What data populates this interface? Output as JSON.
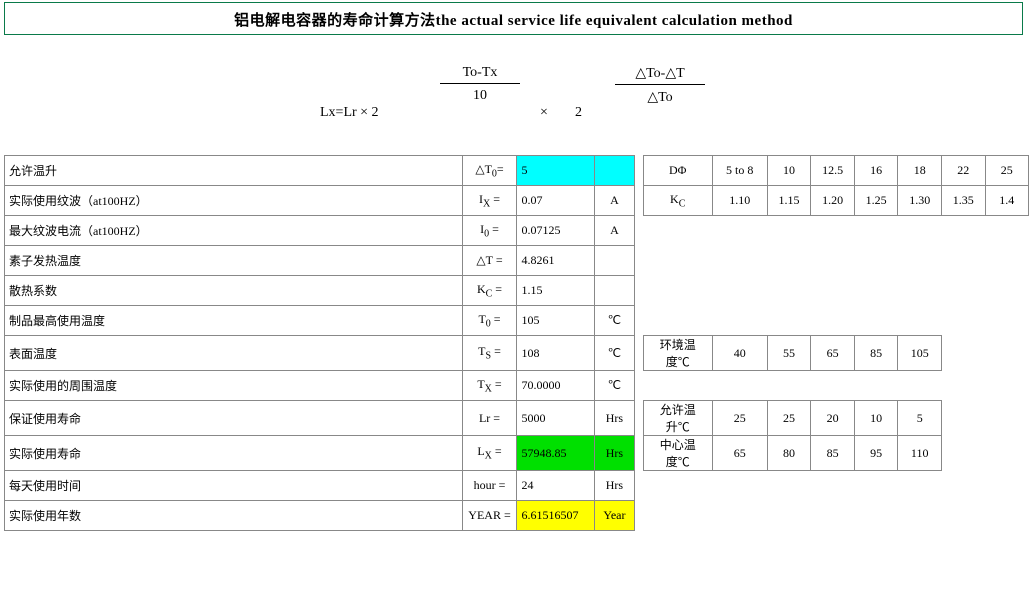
{
  "title": "铝电解电容器的寿命计算方法the actual service life equivalent calculation method",
  "formula": {
    "prefix": "Lx=Lr × 2",
    "frac1_num": "To-Tx",
    "frac1_den": "10",
    "times": "×",
    "base2": "2",
    "frac2_num": "△To-△T",
    "frac2_den": "△To"
  },
  "rows": {
    "r1": {
      "label": "允许温升",
      "sym": "△T0=",
      "val": "5",
      "unit": ""
    },
    "r2": {
      "label": "实际使用纹波（at100HZ）",
      "sym": "IX =",
      "val": "0.07",
      "unit": "A"
    },
    "r3": {
      "label": "最大纹波电流（at100HZ）",
      "sym": "I0 =",
      "val": "0.07125",
      "unit": "A"
    },
    "r4": {
      "label": "素子发热温度",
      "sym": "△T =",
      "val": "4.8261",
      "unit": ""
    },
    "r5": {
      "label": "散热系数",
      "sym": "KC =",
      "val": "1.15",
      "unit": ""
    },
    "r6": {
      "label": "制品最高使用温度",
      "sym": "T0 =",
      "val": "105",
      "unit": "℃"
    },
    "r7": {
      "label": "表面温度",
      "sym": "TS =",
      "val": "108",
      "unit": "℃"
    },
    "r8": {
      "label": "实际使用的周围温度",
      "sym": "TX =",
      "val": "70.0000",
      "unit": "℃"
    },
    "r9": {
      "label": "保证使用寿命",
      "sym": "Lr =",
      "val": "5000",
      "unit": "Hrs"
    },
    "r10": {
      "label": "实际使用寿命",
      "sym": "LX =",
      "val": "57948.85",
      "unit": "Hrs"
    },
    "r11": {
      "label": "每天使用时间",
      "sym": "hour =",
      "val": "24",
      "unit": "Hrs"
    },
    "r12": {
      "label": "实际使用年数",
      "sym": "YEAR =",
      "val": "6.61516507",
      "unit": "Year"
    }
  },
  "dphi": {
    "label": "DΦ",
    "h": [
      "5 to 8",
      "10",
      "12.5",
      "16",
      "18",
      "22",
      "25"
    ]
  },
  "kc": {
    "label": "KC",
    "h": [
      "1.10",
      "1.15",
      "1.20",
      "1.25",
      "1.30",
      "1.35",
      "1.4"
    ]
  },
  "env_temp": {
    "label": "环境温度℃",
    "h": [
      "40",
      "55",
      "65",
      "85",
      "105"
    ]
  },
  "allow_rise": {
    "label": "允许温升℃",
    "h": [
      "25",
      "25",
      "20",
      "10",
      "5"
    ]
  },
  "center_temp": {
    "label": "中心温度℃",
    "h": [
      "65",
      "80",
      "85",
      "95",
      "110"
    ]
  }
}
